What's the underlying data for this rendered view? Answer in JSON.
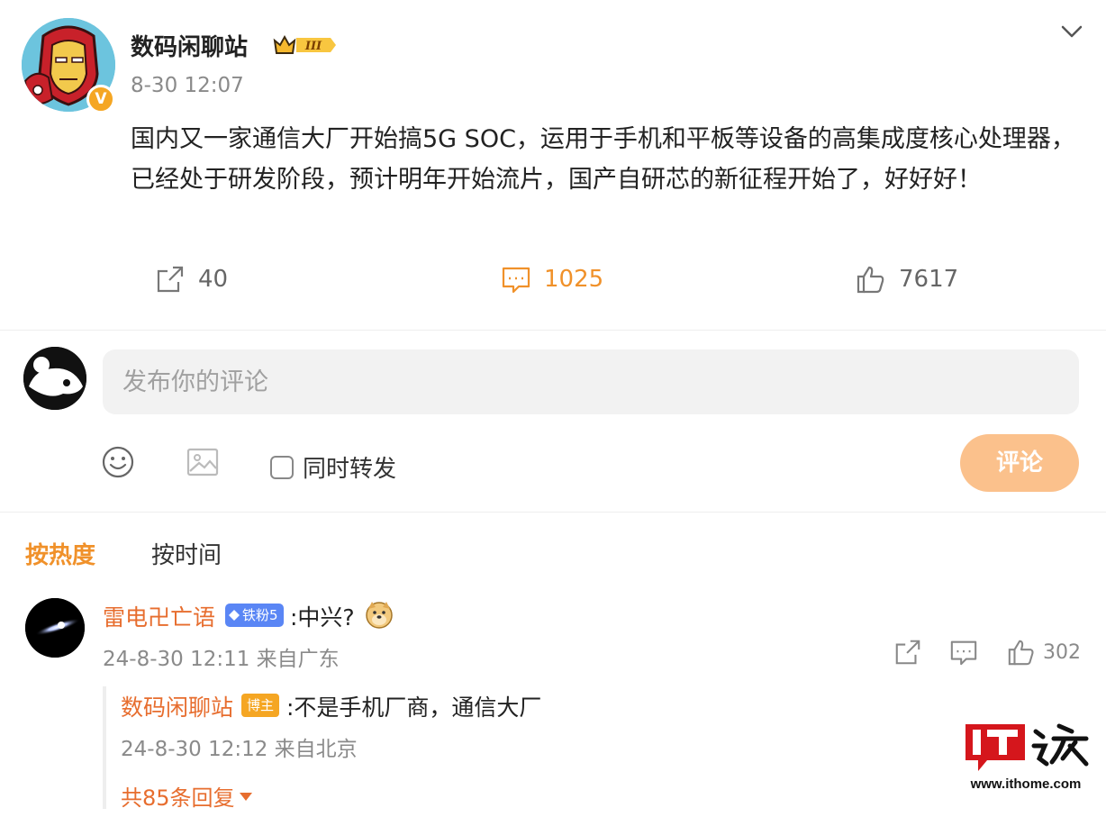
{
  "post": {
    "username": "数码闲聊站",
    "level_badge": "III",
    "verified_badge": "V",
    "time": "8-30 12:07",
    "content": "国内又一家通信大厂开始搞5G SOC，运用于手机和平板等设备的高集成度核心处理器，已经处于研发阶段，预计明年开始流片，国产自研芯的新征程开始了，好好好！",
    "reposts": "40",
    "comments": "1025",
    "likes": "7617"
  },
  "composer": {
    "placeholder": "发布你的评论",
    "repost_label": "同时转发",
    "submit_label": "评论"
  },
  "sort": {
    "hot": "按热度",
    "time": "按时间"
  },
  "comment": {
    "username": "雷电卍亡语",
    "fan_badge": "铁粉5",
    "text": ":中兴?",
    "meta": "24-8-30 12:11 来自广东",
    "likes": "302"
  },
  "reply": {
    "username": "数码闲聊站",
    "badge": "博主",
    "text": ":不是手机厂商，通信大厂",
    "meta": "24-8-30 12:12 来自北京",
    "more": "共85条回复"
  },
  "watermark": {
    "logo": "IT之家",
    "url": "www.ithome.com"
  },
  "colors": {
    "accent": "#f0912a",
    "username": "#e76d2e",
    "button_disabled": "#fbc18c",
    "fan_badge": "#5a86f5",
    "watermark_red": "#d5161c"
  }
}
